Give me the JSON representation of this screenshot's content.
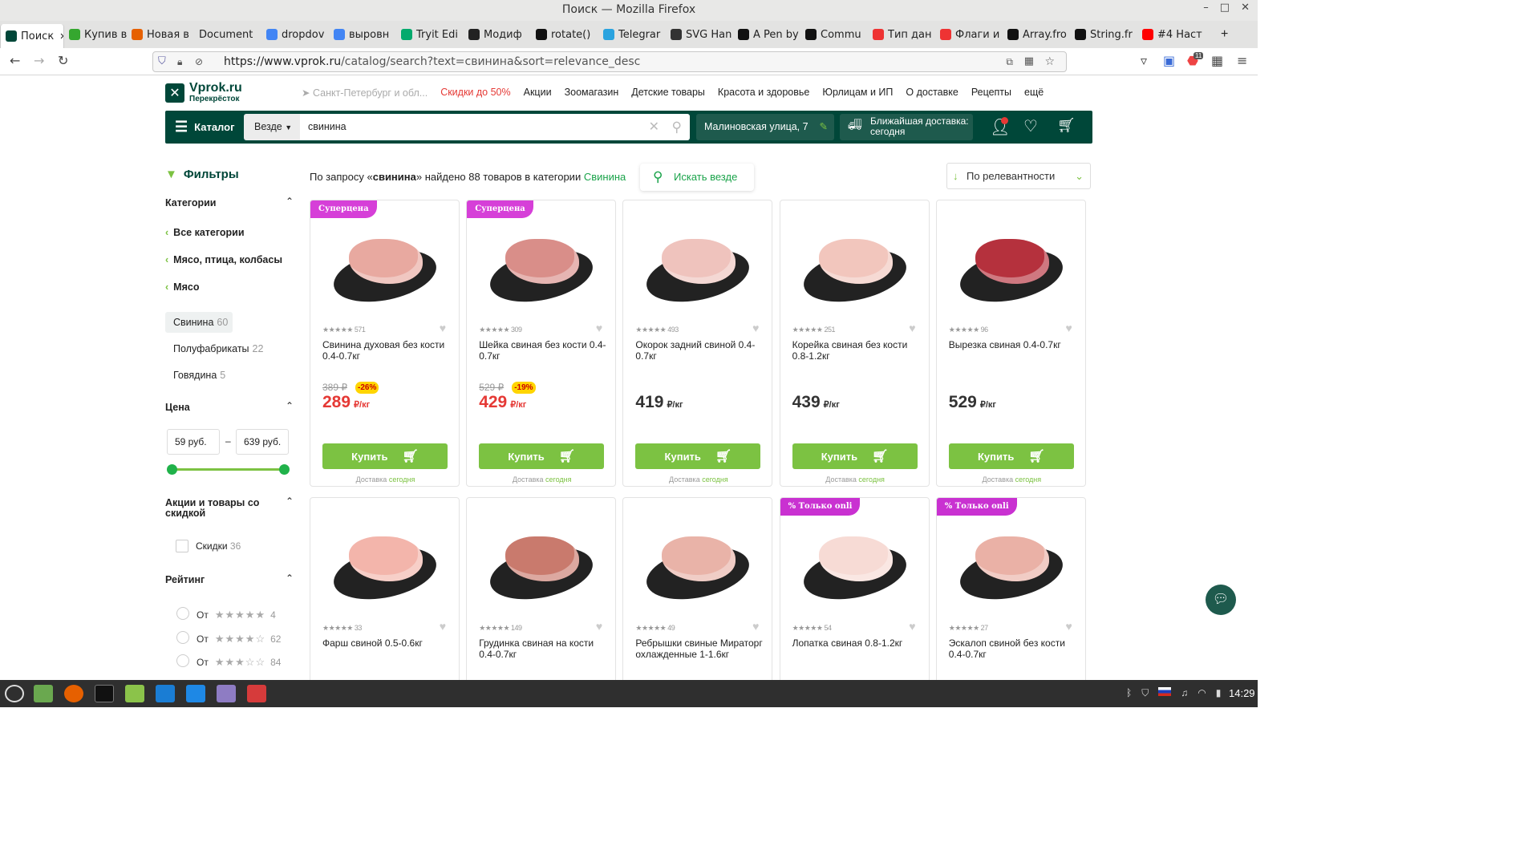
{
  "window": {
    "title": "Поиск — Mozilla Firefox"
  },
  "tabs": [
    {
      "label": "Поиск",
      "icon": "vprok-icon",
      "color": "#004739",
      "active": true
    },
    {
      "label": "Купив в",
      "icon": "green-icon",
      "color": "#35a72f"
    },
    {
      "label": "Новая в",
      "icon": "firefox-icon",
      "color": "#e66000"
    },
    {
      "label": "Document",
      "icon": "",
      "color": ""
    },
    {
      "label": "dropdov",
      "icon": "google-icon",
      "color": "#4285f4"
    },
    {
      "label": "выровн",
      "icon": "google-icon",
      "color": "#4285f4"
    },
    {
      "label": "Tryit Edi",
      "icon": "w3-icon",
      "color": "#04aa6d"
    },
    {
      "label": "Модиф",
      "icon": "doc-icon",
      "color": "#222"
    },
    {
      "label": "rotate()",
      "icon": "mdn-icon",
      "color": "#111"
    },
    {
      "label": "Telegrar",
      "icon": "telegram-icon",
      "color": "#2aa3df"
    },
    {
      "label": "SVG Han",
      "icon": "svg-icon",
      "color": "#333"
    },
    {
      "label": "A Pen by",
      "icon": "codepen-icon",
      "color": "#111"
    },
    {
      "label": "Commu",
      "icon": "dark-icon",
      "color": "#111"
    },
    {
      "label": "Тип дан",
      "icon": "red-icon",
      "color": "#e33"
    },
    {
      "label": "Флаги и",
      "icon": "red-icon",
      "color": "#e33"
    },
    {
      "label": "Array.fro",
      "icon": "mdn-icon",
      "color": "#111"
    },
    {
      "label": "String.fr",
      "icon": "mdn-icon",
      "color": "#111"
    },
    {
      "label": "#4 Наст",
      "icon": "youtube-icon",
      "color": "#f00"
    }
  ],
  "url": {
    "base": "https://www.vprok.ru",
    "path": "/catalog/search?text=свинина&sort=relevance_desc",
    "badge_count": "11"
  },
  "site": {
    "logo_name": "Vprok.ru",
    "logo_sub": "Перекрёсток",
    "location": "Санкт-Петербург и обл...",
    "nav": [
      {
        "label": "Скидки до 50%",
        "color": "#e53935"
      },
      {
        "label": "Акции"
      },
      {
        "label": "Зоомагазин"
      },
      {
        "label": "Детские товары"
      },
      {
        "label": "Красота и здоровье"
      },
      {
        "label": "Юрлицам и ИП"
      },
      {
        "label": "О доставке"
      },
      {
        "label": "Рецепты"
      },
      {
        "label": "ещё"
      }
    ],
    "catalog_label": "Каталог",
    "scope_label": "Везде",
    "search_value": "свинина",
    "address": "Малиновская улица, 7",
    "delivery": "Ближайшая доставка: сегодня"
  },
  "results": {
    "prefix": "По запросу «",
    "query": "свинина",
    "mid": "» найдено 88 товаров в категории",
    "category": "Свинина",
    "search_everywhere": "Искать везде",
    "sort": "По релевантности"
  },
  "filters": {
    "title": "Фильтры",
    "categories_title": "Категории",
    "crumbs": [
      "Все категории",
      "Мясо, птица, колбасы",
      "Мясо"
    ],
    "subcats": [
      {
        "label": "Свинина",
        "count": "60",
        "selected": true
      },
      {
        "label": "Полуфабрикаты",
        "count": "22"
      },
      {
        "label": "Говядина",
        "count": "5"
      }
    ],
    "price_title": "Цена",
    "price_min": "59 руб.",
    "price_max": "639 руб.",
    "promo_title": "Акции и товары со скидкой",
    "discount_label": "Скидки",
    "discount_count": "36",
    "rating_title": "Рейтинг",
    "ratings": [
      {
        "label": "От",
        "stars": 5,
        "count": "4"
      },
      {
        "label": "От",
        "stars": 4,
        "count": "62"
      },
      {
        "label": "От",
        "stars": 3,
        "count": "84"
      }
    ]
  },
  "buy_label": "Купить",
  "delivery_note": "Доставка",
  "delivery_today": "сегодня",
  "products": [
    {
      "badge": "Суперцена",
      "reviews": "571",
      "name": "Свинина духовая без кости 0.4-0.7кг",
      "old": "389 ₽",
      "disc": "-26%",
      "price": "289",
      "unit": "₽/кг",
      "sale": true
    },
    {
      "badge": "Суперцена",
      "reviews": "309",
      "name": "Шейка свиная без кости 0.4-0.7кг",
      "old": "529 ₽",
      "disc": "-19%",
      "price": "429",
      "unit": "₽/кг",
      "sale": true
    },
    {
      "badge": "",
      "reviews": "493",
      "name": "Окорок задний свиной 0.4-0.7кг",
      "old": "",
      "disc": "",
      "price": "419",
      "unit": "₽/кг",
      "sale": false
    },
    {
      "badge": "",
      "reviews": "251",
      "name": "Корейка свиная без кости 0.8-1.2кг",
      "old": "",
      "disc": "",
      "price": "439",
      "unit": "₽/кг",
      "sale": false
    },
    {
      "badge": "",
      "reviews": "96",
      "name": "Вырезка свиная 0.4-0.7кг",
      "old": "",
      "disc": "",
      "price": "529",
      "unit": "₽/кг",
      "sale": false
    },
    {
      "badge": "",
      "reviews": "33",
      "name": "Фарш свиной 0.5-0.6кг"
    },
    {
      "badge": "",
      "reviews": "149",
      "name": "Грудинка свиная на кости 0.4-0.7кг"
    },
    {
      "badge": "",
      "reviews": "49",
      "name": "Ребрышки свиные Мираторг охлажденные 1-1.6кг"
    },
    {
      "badge": "% Только onli",
      "reviews": "54",
      "name": "Лопатка свиная 0.8-1.2кг"
    },
    {
      "badge": "% Только onli",
      "reviews": "27",
      "name": "Эскалоп свиной без кости 0.4-0.7кг"
    }
  ],
  "taskbar": {
    "clock": "14:29"
  }
}
